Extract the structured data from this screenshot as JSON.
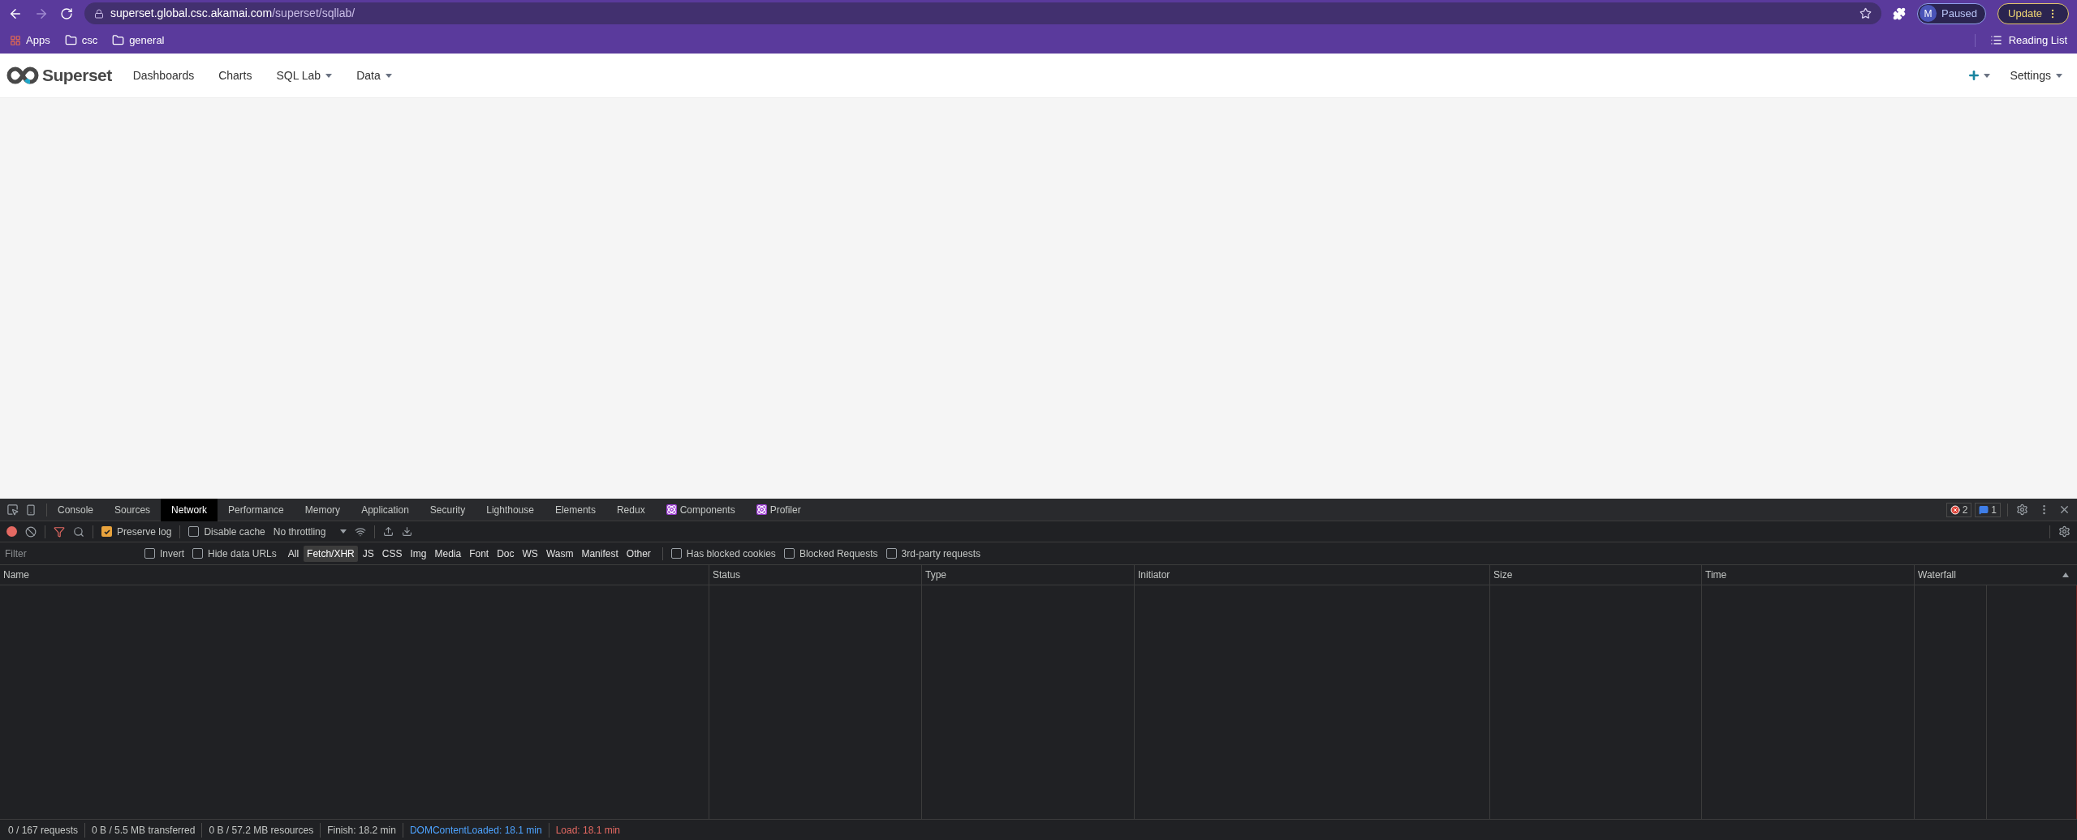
{
  "browser": {
    "url_host": "superset.global.csc.akamai.com",
    "url_path": "/superset/sqllab/",
    "profile_initial": "M",
    "profile_status": "Paused",
    "update_button": "Update",
    "bookmarks": [
      {
        "kind": "apps",
        "label": "Apps"
      },
      {
        "kind": "folder",
        "label": "csc"
      },
      {
        "kind": "folder",
        "label": "general"
      }
    ],
    "reading_list": "Reading List"
  },
  "app_nav": {
    "brand": "Superset",
    "items": [
      {
        "label": "Dashboards",
        "dropdown": false
      },
      {
        "label": "Charts",
        "dropdown": false
      },
      {
        "label": "SQL Lab",
        "dropdown": true
      },
      {
        "label": "Data",
        "dropdown": true
      }
    ],
    "settings": "Settings"
  },
  "devtools": {
    "tabs": [
      {
        "label": "Console",
        "selected": false,
        "react": false
      },
      {
        "label": "Sources",
        "selected": false,
        "react": false
      },
      {
        "label": "Network",
        "selected": true,
        "react": false
      },
      {
        "label": "Performance",
        "selected": false,
        "react": false
      },
      {
        "label": "Memory",
        "selected": false,
        "react": false
      },
      {
        "label": "Application",
        "selected": false,
        "react": false
      },
      {
        "label": "Security",
        "selected": false,
        "react": false
      },
      {
        "label": "Lighthouse",
        "selected": false,
        "react": false
      },
      {
        "label": "Elements",
        "selected": false,
        "react": false
      },
      {
        "label": "Redux",
        "selected": false,
        "react": false
      },
      {
        "label": "Components",
        "selected": false,
        "react": true
      },
      {
        "label": "Profiler",
        "selected": false,
        "react": true
      }
    ],
    "error_count": "2",
    "message_count": "1",
    "preserve_log": {
      "label": "Preserve log",
      "checked": true
    },
    "disable_cache": {
      "label": "Disable cache",
      "checked": false
    },
    "throttling": "No throttling",
    "filter": {
      "placeholder": "Filter"
    },
    "filter_options": [
      {
        "label": "Invert",
        "checked": false
      },
      {
        "label": "Hide data URLs",
        "checked": false
      }
    ],
    "types": [
      {
        "label": "All",
        "selected": false
      },
      {
        "label": "Fetch/XHR",
        "selected": true
      },
      {
        "label": "JS",
        "selected": false
      },
      {
        "label": "CSS",
        "selected": false
      },
      {
        "label": "Img",
        "selected": false
      },
      {
        "label": "Media",
        "selected": false
      },
      {
        "label": "Font",
        "selected": false
      },
      {
        "label": "Doc",
        "selected": false
      },
      {
        "label": "WS",
        "selected": false
      },
      {
        "label": "Wasm",
        "selected": false
      },
      {
        "label": "Manifest",
        "selected": false
      },
      {
        "label": "Other",
        "selected": false
      }
    ],
    "extra_options": [
      {
        "label": "Has blocked cookies",
        "checked": false
      },
      {
        "label": "Blocked Requests",
        "checked": false
      },
      {
        "label": "3rd-party requests",
        "checked": false
      }
    ],
    "columns": [
      "Name",
      "Status",
      "Type",
      "Initiator",
      "Size",
      "Time",
      "Waterfall"
    ],
    "status_bar": [
      {
        "text": "0 / 167 requests",
        "kind": "plain"
      },
      {
        "text": "0 B / 5.5 MB transferred",
        "kind": "plain"
      },
      {
        "text": "0 B / 57.2 MB resources",
        "kind": "plain"
      },
      {
        "text": "Finish: 18.2 min",
        "kind": "plain"
      },
      {
        "text": "DOMContentLoaded: 18.1 min",
        "kind": "dom"
      },
      {
        "text": "Load: 18.1 min",
        "kind": "load"
      }
    ]
  }
}
